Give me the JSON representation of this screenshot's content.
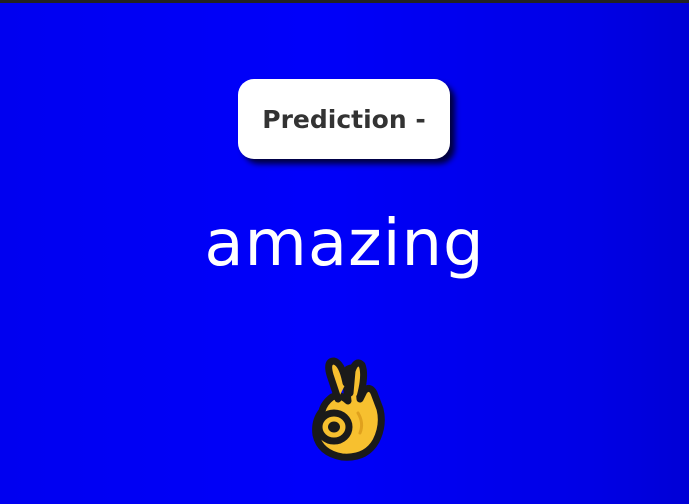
{
  "prediction": {
    "label": "Prediction -",
    "word": "amazing",
    "emoji_icon": "ok-hand-icon"
  },
  "colors": {
    "background": "#0000f0",
    "pill": "#ffffff",
    "pill_text": "#333333",
    "word_text": "#ffffff",
    "emoji_skin": "#f7c02f"
  }
}
